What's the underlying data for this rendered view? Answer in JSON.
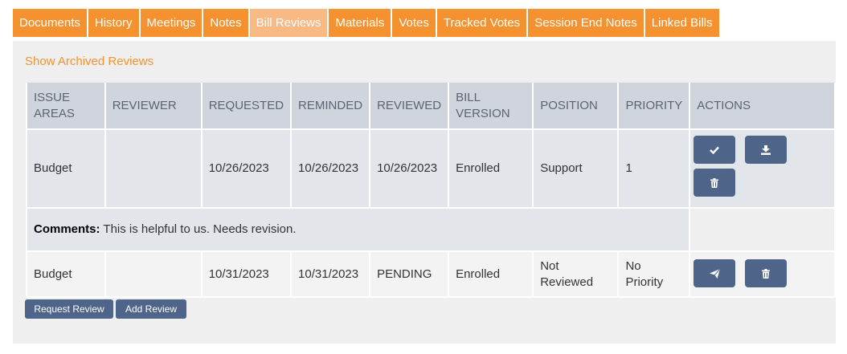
{
  "tabs": [
    "Documents",
    "History",
    "Meetings",
    "Notes",
    "Bill Reviews",
    "Materials",
    "Votes",
    "Tracked Votes",
    "Session End Notes",
    "Linked Bills"
  ],
  "active_tab": "Bill Reviews",
  "show_archived": "Show Archived Reviews",
  "columns": {
    "issue_areas_1": "ISSUE",
    "issue_areas_2": "AREAS",
    "reviewer": "REVIEWER",
    "requested": "REQUESTED",
    "reminded": "REMINDED",
    "reviewed": "REVIEWED",
    "bill_version_1": "BILL",
    "bill_version_2": "VERSION",
    "position": "POSITION",
    "priority": "PRIORITY",
    "actions": "ACTIONS"
  },
  "rows": [
    {
      "issue_area": "Budget",
      "reviewer": "",
      "requested": "10/26/2023",
      "reminded": "10/26/2023",
      "reviewed": "10/26/2023",
      "bill_version": "Enrolled",
      "position": "Support",
      "priority": "1",
      "comments_label": "Comments:",
      "comments": "This is helpful to us. Needs revision.",
      "actions": [
        "check-icon",
        "download-icon",
        "trash-icon"
      ]
    },
    {
      "issue_area": "Budget",
      "reviewer": "",
      "requested": "10/31/2023",
      "reminded": "10/31/2023",
      "reviewed": "PENDING",
      "bill_version": "Enrolled",
      "position_1": "Not",
      "position_2": "Reviewed",
      "priority_1": "No",
      "priority_2": "Priority",
      "actions": [
        "send-icon",
        "trash-icon"
      ]
    }
  ],
  "buttons": {
    "request_review": "Request Review",
    "add_review": "Add Review"
  },
  "colors": {
    "tab_orange": "#f5922f",
    "tab_active": "#f8b985",
    "button_blue": "#4e6489",
    "header_gray": "#d0d5dd"
  }
}
